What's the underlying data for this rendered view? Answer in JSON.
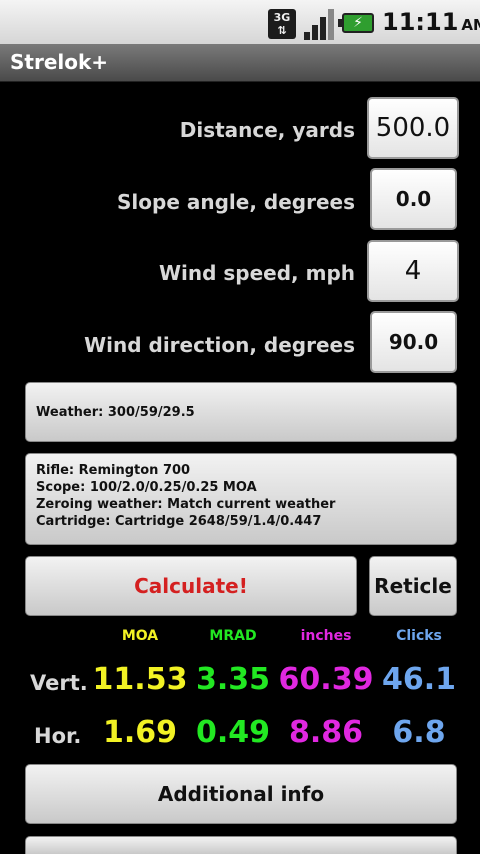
{
  "status_bar": {
    "network": "3G",
    "time": "11:11",
    "ampm": "AM"
  },
  "app": {
    "title": "Strelok+"
  },
  "inputs": {
    "distance": {
      "label": "Distance, yards",
      "value": "500.0"
    },
    "slope": {
      "label": "Slope angle, degrees",
      "value": "0.0"
    },
    "wind_speed": {
      "label": "Wind speed, mph",
      "value": "4"
    },
    "wind_direction": {
      "label": "Wind direction, degrees",
      "value": "90.0"
    }
  },
  "weather_button": {
    "label": "Weather: 300/59/29.5"
  },
  "profile_button": {
    "rifle": "Rifle: Remington 700",
    "scope": "Scope: 100/2.0/0.25/0.25 MOA",
    "zeroing": "Zeroing weather: Match current weather",
    "cartridge": "Cartridge: Cartridge 2648/59/1.4/0.447"
  },
  "actions": {
    "calculate": "Calculate!",
    "reticle": "Reticle",
    "additional_info": "Additional info"
  },
  "results": {
    "headers": {
      "moa": "MOA",
      "mrad": "MRAD",
      "inches": "inches",
      "clicks": "Clicks"
    },
    "vert": {
      "label": "Vert.",
      "moa": "11.53",
      "mrad": "3.35",
      "inches": "60.39",
      "clicks": "46.1"
    },
    "hor": {
      "label": "Hor.",
      "moa": "1.69",
      "mrad": "0.49",
      "inches": "8.86",
      "clicks": "6.8"
    }
  },
  "colors": {
    "calculate_text": "#d42020",
    "moa": "#f2f224",
    "mrad": "#22e822",
    "inches": "#e028e0",
    "clicks": "#6ea6ee"
  }
}
